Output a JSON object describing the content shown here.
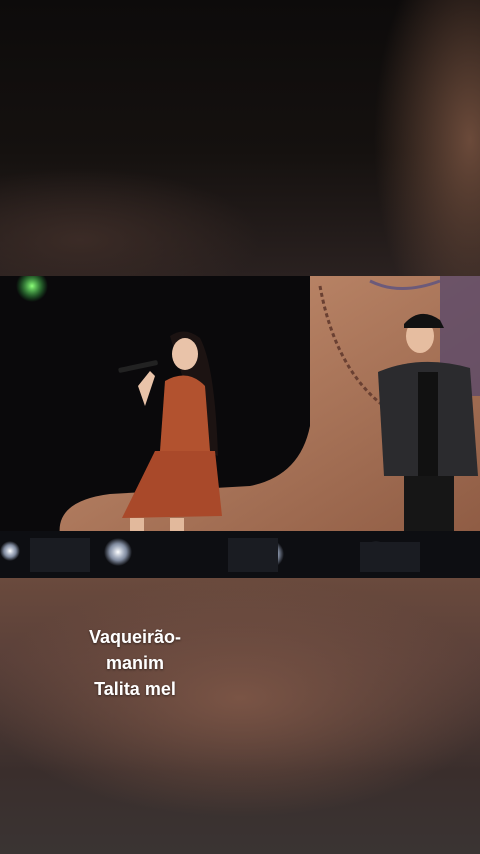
{
  "caption": {
    "line1": "Vaqueirão-",
    "line2": "manim",
    "line3": "Talita mel"
  },
  "colors": {
    "stage_brown": "#b07a52",
    "dress": "#b2522f",
    "jacket": "#2b2b2e",
    "stage_light": "#dfe8ff"
  }
}
